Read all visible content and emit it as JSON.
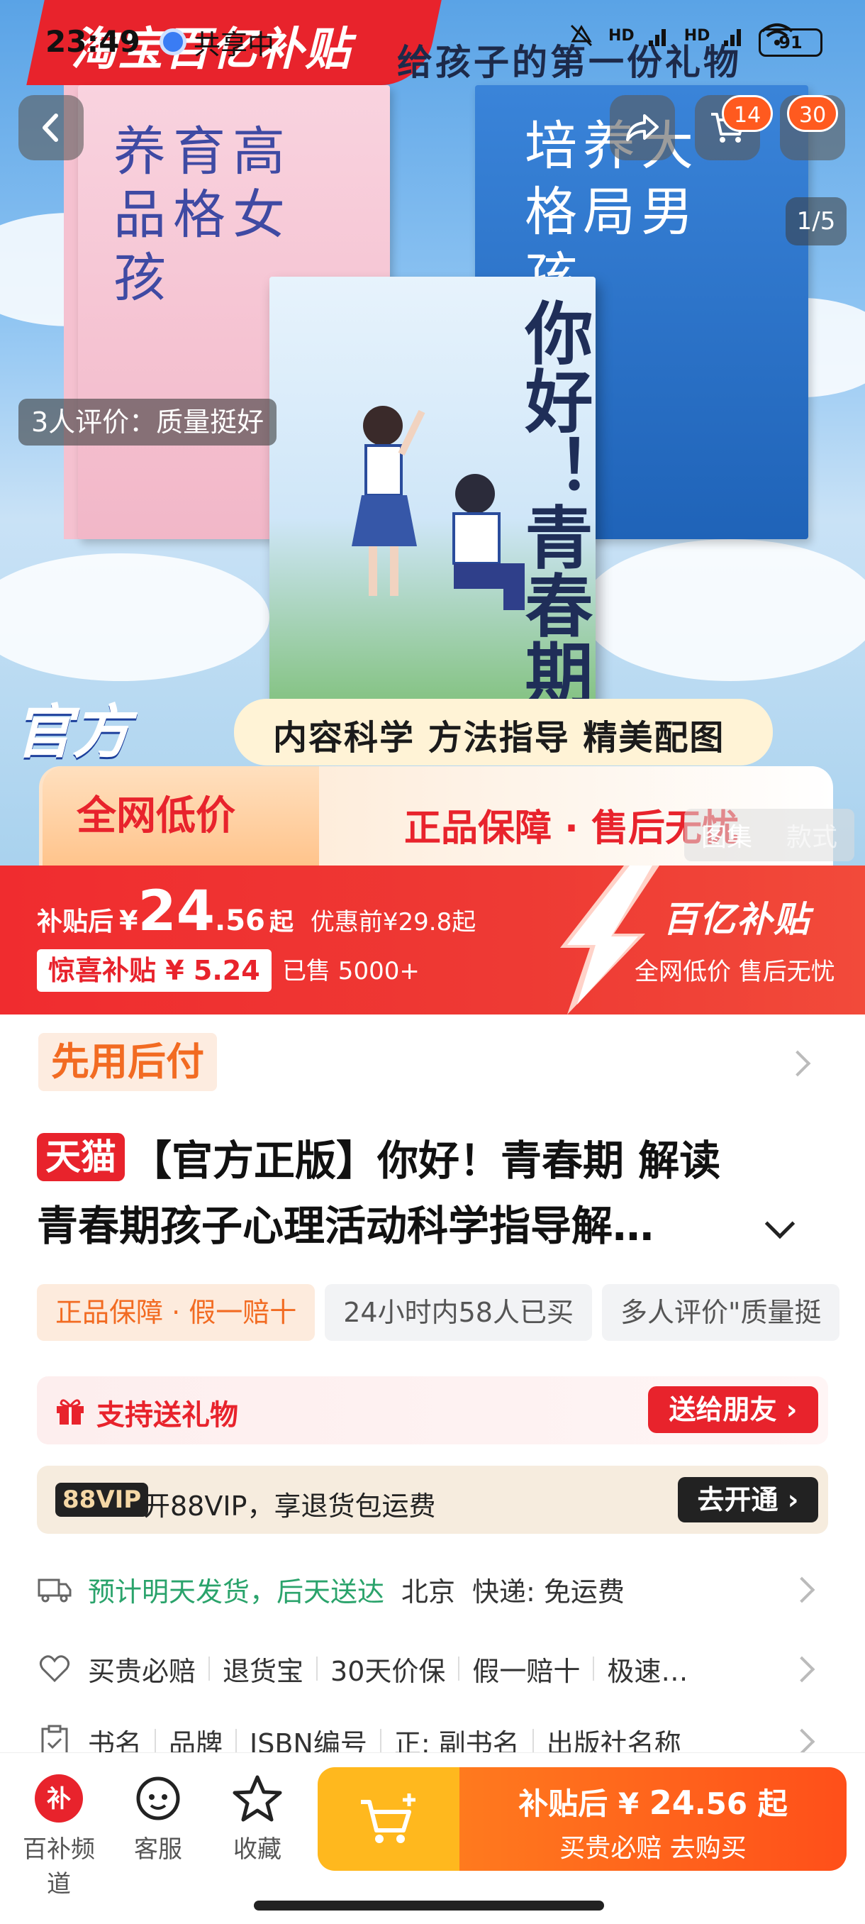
{
  "status_bar": {
    "time": "23:49",
    "share_status": "共享中",
    "signal_hd_1": "HD",
    "signal_hd_2": "HD",
    "battery": "91"
  },
  "hero": {
    "promo_ribbon": "淘宝百亿补贴",
    "top_banner": "给孩子的第一份礼物",
    "book_pink_title": "养育高品格女孩",
    "book_blue_title": "培养大格局男孩",
    "book_main_title": "你好！青春期",
    "features": "内容科学  方法指导  精美配图",
    "official_tag": "官方",
    "low_price": "全网低价",
    "guarantee": "正品保障 · 售后无忧",
    "review_pill": "3人评价：质量挺好",
    "pager": "1/5",
    "cart_badge": "14",
    "more_badge": "30",
    "tab_gallery": "图集",
    "tab_style": "款式"
  },
  "price": {
    "prefix": "补贴后",
    "yen": "¥",
    "integer": "24",
    "decimal": ".56",
    "suffix": "起",
    "original": "优惠前¥29.8起",
    "subsidy": "惊喜补贴 ¥ 5.24",
    "sold": "已售 5000+",
    "brand": "百亿补贴",
    "brand_sub": "全网低价 售后无忧"
  },
  "content": {
    "pay_later": "先用后付",
    "tmall_badge": "天猫",
    "title_line1": "【官方正版】你好！青春期 解读",
    "title_line2": "青春期孩子心理活动科学指导解…",
    "tags": [
      "正品保障 · 假一赔十",
      "24小时内58人已买",
      "多人评价\"质量挺"
    ],
    "gift_text": "支持送礼物",
    "gift_button": "送给朋友 ›",
    "vip_badge": "88VIP",
    "vip_text": "开88VIP，享退货包运费",
    "vip_button": "去开通 ›",
    "shipping": {
      "estimate": "预计明天发货，后天送达",
      "city": "北京",
      "courier": "快递: 免运费"
    },
    "services": [
      "买贵必赔",
      "退货宝",
      "30天价保",
      "假一赔十",
      "极速…"
    ],
    "specs": [
      "书名",
      "品牌",
      "ISBN编号",
      "正: 副书名",
      "出版社名称"
    ]
  },
  "bottom_bar": {
    "nav": [
      {
        "label": "百补频道",
        "icon": "subsidy-channel-icon"
      },
      {
        "label": "客服",
        "icon": "customer-service-icon"
      },
      {
        "label": "收藏",
        "icon": "star-icon"
      }
    ],
    "buy_line1_prefix": "补贴后 ¥ ",
    "buy_line1_price": "24",
    "buy_line1_decimal": ".56",
    "buy_line1_suffix": " 起",
    "buy_line2": "买贵必赔  去购买"
  },
  "colors": {
    "accent_red": "#e8232c",
    "accent_orange": "#ff6a1e",
    "green": "#2aa36b"
  }
}
